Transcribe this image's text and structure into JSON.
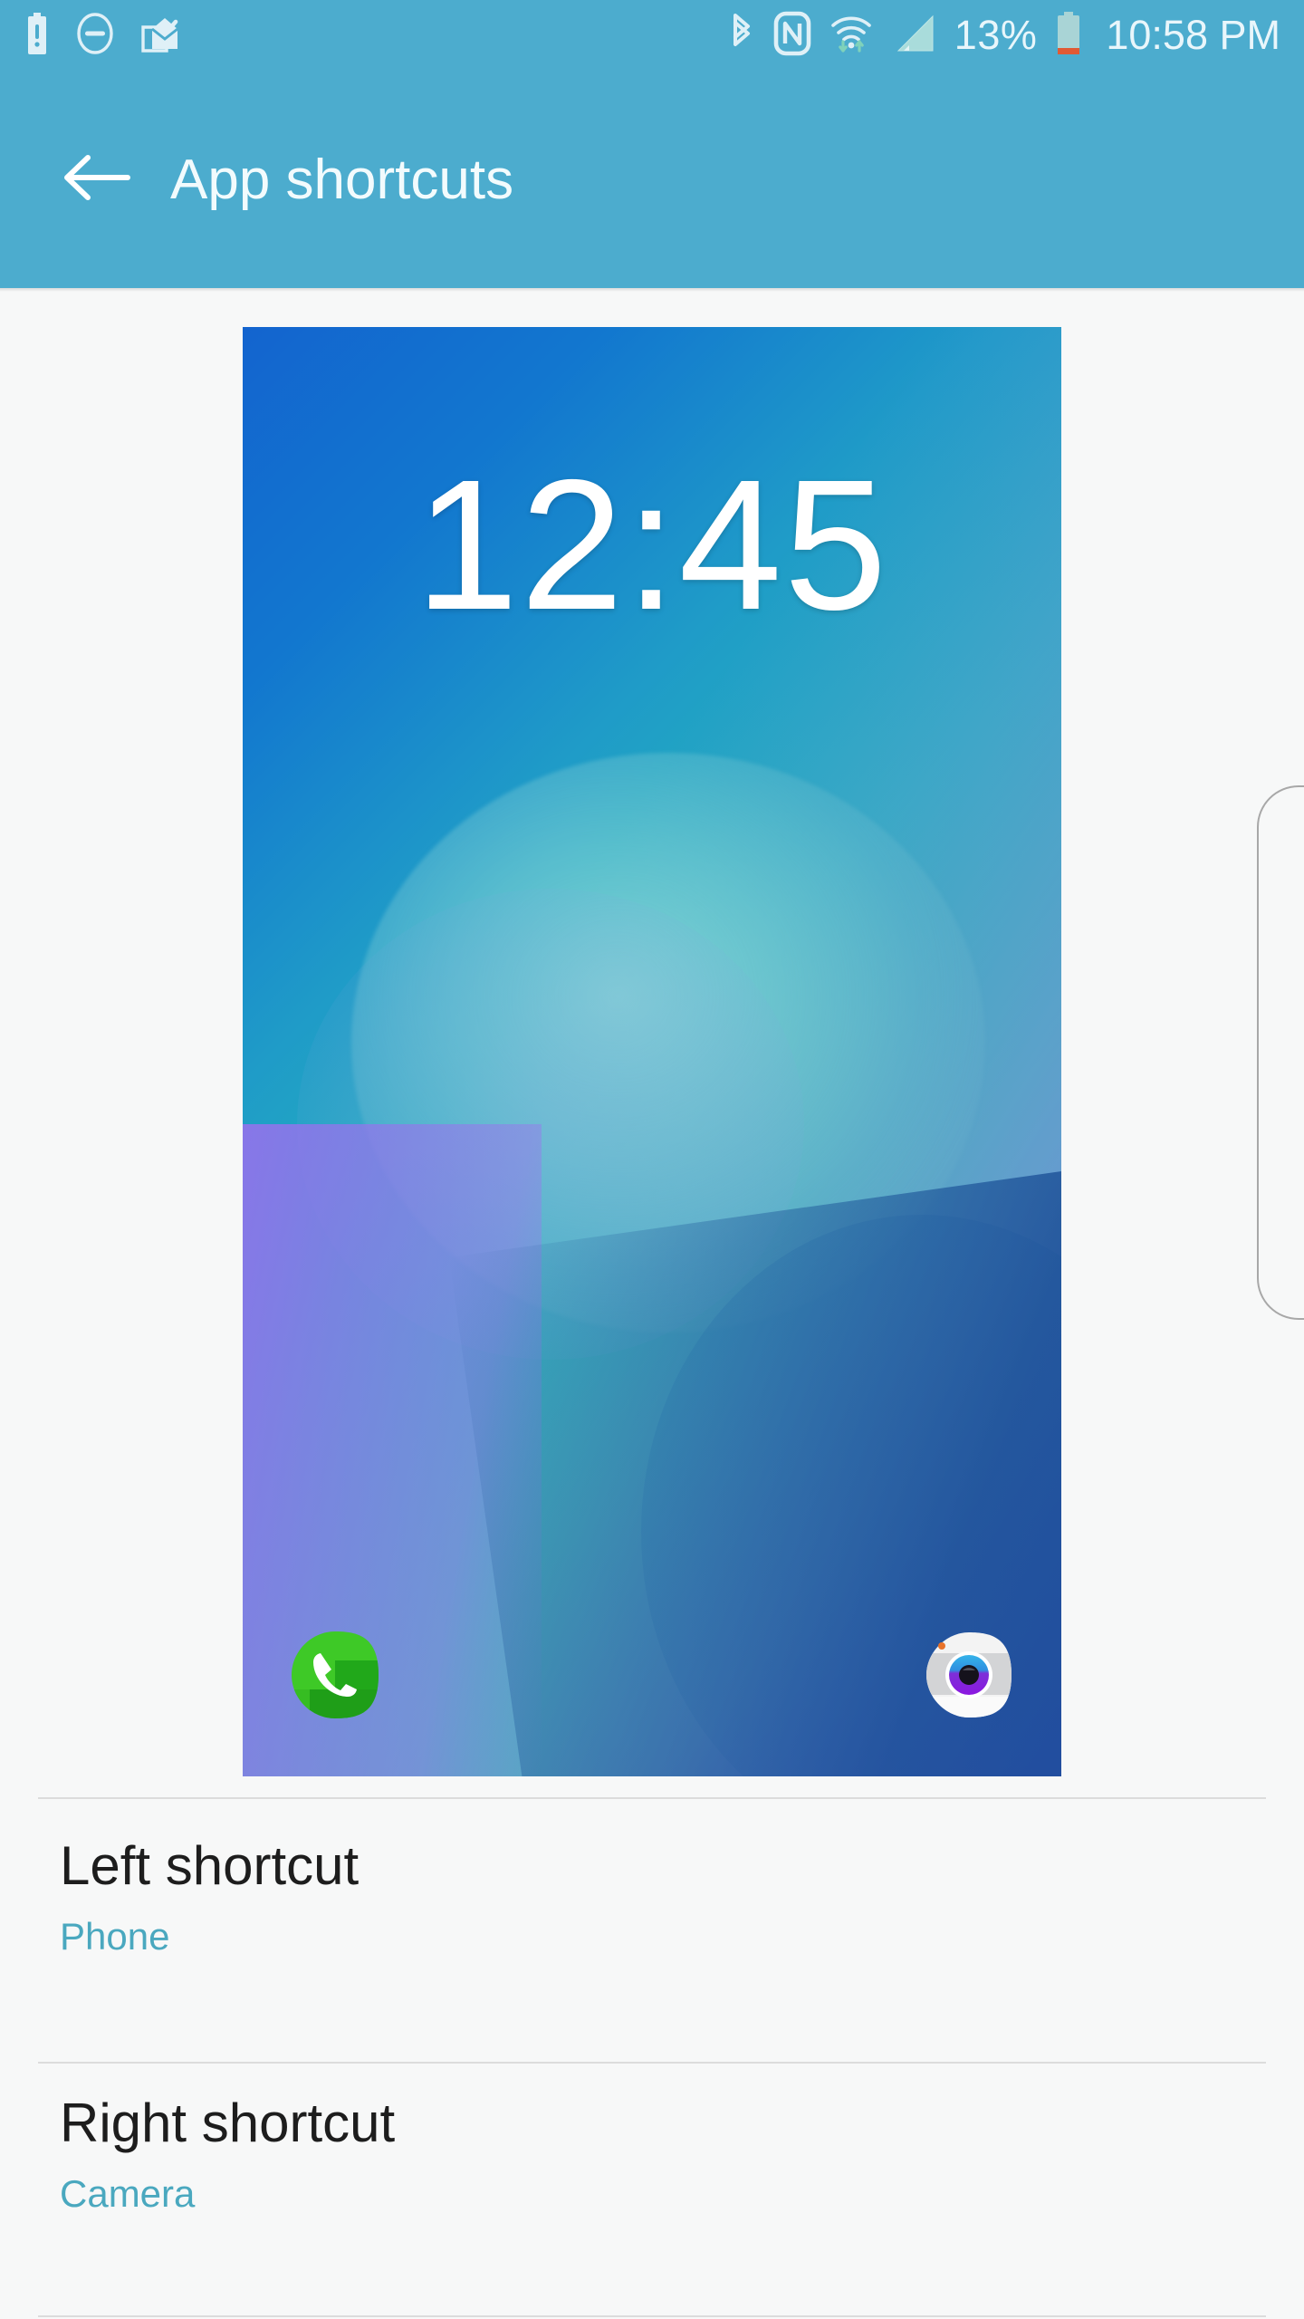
{
  "statusbar": {
    "left_icons": [
      {
        "name": "battery-warning-icon",
        "label": "Battery warning"
      },
      {
        "name": "do-not-disturb-icon",
        "label": "Do not disturb"
      },
      {
        "name": "mail-read-icon",
        "label": "Mail"
      }
    ],
    "right_icons": [
      {
        "name": "bluetooth-icon",
        "label": "Bluetooth"
      },
      {
        "name": "nfc-icon",
        "label": "NFC"
      },
      {
        "name": "wifi-icon",
        "label": "Wi-Fi"
      },
      {
        "name": "cellular-signal-icon",
        "label": "Signal"
      }
    ],
    "battery_percent": "13%",
    "time": "10:58 PM",
    "background_color": "#4cacce",
    "text_color": "#e9f6fb"
  },
  "appbar": {
    "title": "App shortcuts",
    "back_icon": "back-arrow-icon",
    "background_color": "#4cacce"
  },
  "preview": {
    "clock": "12:45",
    "left_shortcut_icon": "phone-icon",
    "right_shortcut_icon": "camera-icon"
  },
  "settings": {
    "rows": [
      {
        "title": "Left shortcut",
        "value": "Phone"
      },
      {
        "title": "Right shortcut",
        "value": "Camera"
      }
    ]
  },
  "colors": {
    "accent": "#4aa8bf",
    "app_bar": "#4cacce",
    "page_background": "#f7f8f8",
    "divider": "#dcdcdc",
    "title_text": "#1d1d1d"
  }
}
